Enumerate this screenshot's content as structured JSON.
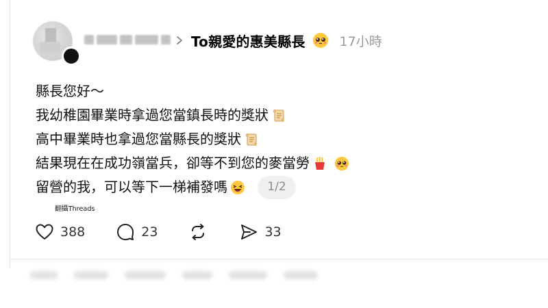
{
  "header": {
    "chevron": "chevron-right-icon",
    "thread_title": "To親愛的惠美縣長",
    "title_emoji": "pleading-face-emoji",
    "time_ago": "17小時"
  },
  "post": {
    "lines": [
      {
        "text": "縣長您好～"
      },
      {
        "text": "我幼稚園畢業時拿過您當鎮長時的獎狀",
        "emoji": "scroll-emoji"
      },
      {
        "text": "高中畢業時也拿過您當縣長的獎狀",
        "emoji": "scroll-emoji"
      },
      {
        "text": "結果現在在成功嶺當兵，卻等不到您的麥當勞",
        "emoji": "fries-emoji",
        "emoji2": "pleading-face-emoji"
      },
      {
        "text": "留營的我，可以等下一梯補發嗎",
        "emoji": "laughing-face-emoji"
      }
    ],
    "page_indicator": "1/2"
  },
  "watermark": "翻攝Threads",
  "actions": {
    "likes": "388",
    "comments": "23",
    "reposts_icon": "repost-icon",
    "shares": "33"
  },
  "colors": {
    "text": "#111111",
    "muted": "#9a9a9a",
    "pill_bg": "#f0f0f0",
    "fries_red": "#e53935",
    "emoji_yellow": "#ffc83d"
  }
}
